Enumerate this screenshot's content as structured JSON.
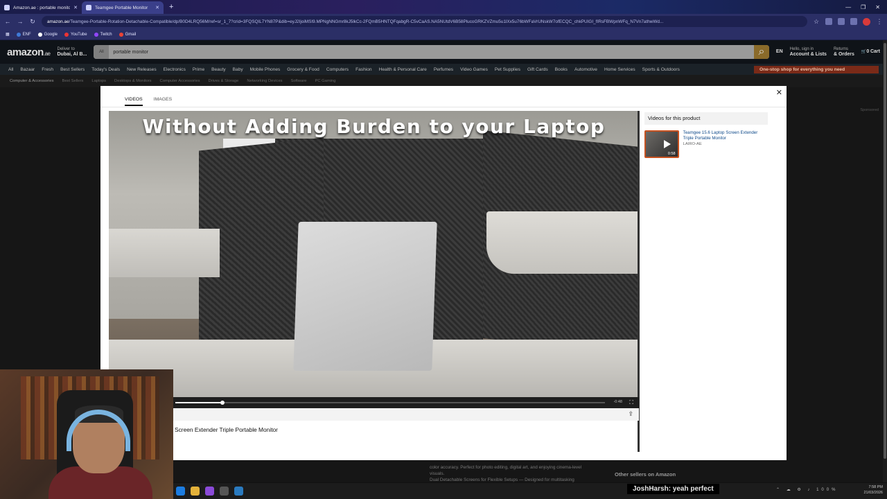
{
  "browser": {
    "tabs": [
      {
        "title": "Amazon.ae : portable monitor",
        "active": false
      },
      {
        "title": "Teamgee Portable Monitor",
        "active": true
      }
    ],
    "url_host": "amazon.ae",
    "url_path": "/Teamgee-Portable-Rotation-Detachable-Compatible/dp/B0D4LRQ56M/ref=sr_1_7?crid=3FQSQIL7YN87P&dib=eyJ2IjoiMSI9.MPNgNNGmr8kJ5lkCc-2FQmB5HNTQFqabgR-C5vCaAS.NA5NUtdV6B58PlucoGRKZVZmu5u1lXx5u76bWFaVrUNskW7ofECQC_chkPUIGI_fIRsFBWpnWFq_N7Vn7athwWd...",
    "bookmarks": [
      "ENF",
      "Google",
      "YouTube",
      "Twitch",
      "Gmail"
    ]
  },
  "amazon": {
    "logo": "amazon",
    "logo_suffix": ".ae",
    "deliver_line1": "Deliver to",
    "deliver_line2": "Dubai, Al B...",
    "search_category": "All",
    "search_query": "portable monitor",
    "language": "EN",
    "account_line1": "Hello, sign in",
    "account_line2": "Account & Lists",
    "orders_line1": "Returns",
    "orders_line2": "& Orders",
    "cart_count": "0",
    "cart_label": "Cart",
    "nav": [
      "All",
      "Bazaar",
      "Fresh",
      "Best Sellers",
      "Today's Deals",
      "New Releases",
      "Electronics",
      "Prime",
      "Beauty",
      "Baby",
      "Mobile Phones",
      "Grocery & Food",
      "Computers",
      "Fashion",
      "Health & Personal Care",
      "Perfumes",
      "Video Games",
      "Pet Supplies",
      "Gift Cards",
      "Books",
      "Automotive",
      "Home Services",
      "Sports & Outdoors"
    ],
    "promo": "One-stop shop for everything you need",
    "subnav": [
      "Computer & Accessories",
      "Best Sellers",
      "Laptops",
      "Desktops & Monitors",
      "Computer Accessories",
      "Drives & Storage",
      "Networking Devices",
      "Software",
      "PC Gaming"
    ],
    "sponsored": "Sponsored",
    "bg_text_1": "color accuracy. Perfect for photo editing, digital art, and enjoying cinema-level visuals.",
    "bg_text_2": "Dual Detachable Screens for Flexible Setups — Designed for multitasking",
    "other_sellers": "Other sellers on Amazon"
  },
  "modal": {
    "tabs": [
      "VIDEOS",
      "IMAGES"
    ],
    "active_tab": "VIDEOS",
    "video_caption": "Without Adding Burden to your Laptop",
    "time_remaining": "-0:48",
    "progress_fraction": 0.11,
    "video_title": "Screen Extender Triple Portable Monitor",
    "side_header": "Videos for this product",
    "side_video": {
      "title": "Teamgee 15.6 Laptop Screen Extender Triple Portable Monitor",
      "subtitle": "LAIRO-AE",
      "duration": "0:58"
    }
  },
  "stream": {
    "chat_user": "JoshHarsh",
    "chat_message": ": yeah perfect"
  },
  "system": {
    "time": "7:58 PM",
    "date": "21/03/2026",
    "battery": "100%"
  },
  "colors": {
    "accent_orange": "#c7511f",
    "amazon_dark": "#0f1318",
    "browser_purple": "#2b2f66"
  }
}
